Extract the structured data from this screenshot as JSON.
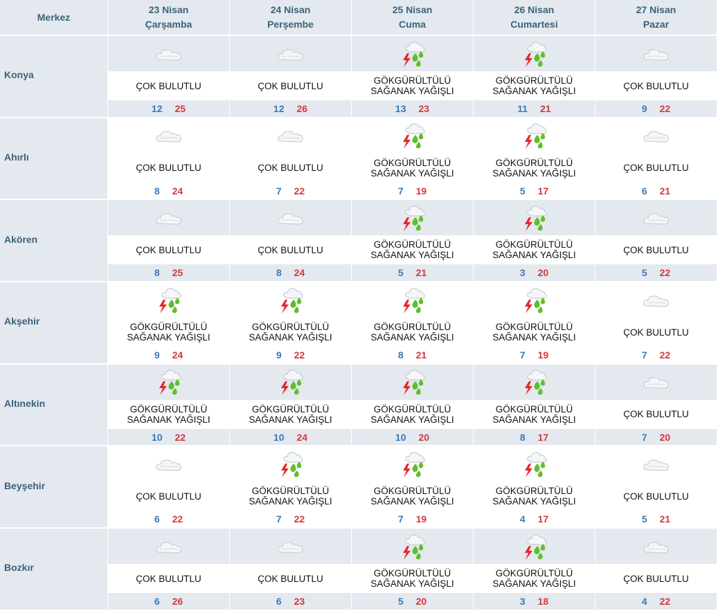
{
  "header": {
    "corner": "Merkez",
    "days": [
      {
        "date": "23 Nisan",
        "weekday": "Çarşamba"
      },
      {
        "date": "24 Nisan",
        "weekday": "Perşembe"
      },
      {
        "date": "25 Nisan",
        "weekday": "Cuma"
      },
      {
        "date": "26 Nisan",
        "weekday": "Cumartesi"
      },
      {
        "date": "27 Nisan",
        "weekday": "Pazar"
      }
    ]
  },
  "colors": {
    "header_bg": "#e3e9ef",
    "header_text": "#3d6277",
    "min_temp": "#3b78b8",
    "max_temp": "#d3393a"
  },
  "rows": [
    {
      "city": "Konya",
      "days": [
        {
          "icon": "cloud-icon",
          "line1": "ÇOK BULUTLU",
          "line2": "",
          "min": "12",
          "max": "25"
        },
        {
          "icon": "cloud-icon",
          "line1": "ÇOK BULUTLU",
          "line2": "",
          "min": "12",
          "max": "26"
        },
        {
          "icon": "thunder-shower-icon",
          "line1": "GÖKGÜRÜLTÜLÜ",
          "line2": "SAĞANAK YAĞIŞLI",
          "min": "13",
          "max": "23"
        },
        {
          "icon": "thunder-shower-icon",
          "line1": "GÖKGÜRÜLTÜLÜ",
          "line2": "SAĞANAK YAĞIŞLI",
          "min": "11",
          "max": "21"
        },
        {
          "icon": "cloud-icon",
          "line1": "ÇOK BULUTLU",
          "line2": "",
          "min": "9",
          "max": "22"
        }
      ]
    },
    {
      "city": "Ahırlı",
      "days": [
        {
          "icon": "cloud-icon",
          "line1": "ÇOK BULUTLU",
          "line2": "",
          "min": "8",
          "max": "24"
        },
        {
          "icon": "cloud-icon",
          "line1": "ÇOK BULUTLU",
          "line2": "",
          "min": "7",
          "max": "22"
        },
        {
          "icon": "thunder-shower-icon",
          "line1": "GÖKGÜRÜLTÜLÜ",
          "line2": "SAĞANAK YAĞIŞLI",
          "min": "7",
          "max": "19"
        },
        {
          "icon": "thunder-shower-icon",
          "line1": "GÖKGÜRÜLTÜLÜ",
          "line2": "SAĞANAK YAĞIŞLI",
          "min": "5",
          "max": "17"
        },
        {
          "icon": "cloud-icon",
          "line1": "ÇOK BULUTLU",
          "line2": "",
          "min": "6",
          "max": "21"
        }
      ]
    },
    {
      "city": "Akören",
      "days": [
        {
          "icon": "cloud-icon",
          "line1": "ÇOK BULUTLU",
          "line2": "",
          "min": "8",
          "max": "25"
        },
        {
          "icon": "cloud-icon",
          "line1": "ÇOK BULUTLU",
          "line2": "",
          "min": "8",
          "max": "24"
        },
        {
          "icon": "thunder-shower-icon",
          "line1": "GÖKGÜRÜLTÜLÜ",
          "line2": "SAĞANAK YAĞIŞLI",
          "min": "5",
          "max": "21"
        },
        {
          "icon": "thunder-shower-icon",
          "line1": "GÖKGÜRÜLTÜLÜ",
          "line2": "SAĞANAK YAĞIŞLI",
          "min": "3",
          "max": "20"
        },
        {
          "icon": "cloud-icon",
          "line1": "ÇOK BULUTLU",
          "line2": "",
          "min": "5",
          "max": "22"
        }
      ]
    },
    {
      "city": "Akşehir",
      "days": [
        {
          "icon": "thunder-shower-icon",
          "line1": "GÖKGÜRÜLTÜLÜ",
          "line2": "SAĞANAK YAĞIŞLI",
          "min": "9",
          "max": "24"
        },
        {
          "icon": "thunder-shower-icon",
          "line1": "GÖKGÜRÜLTÜLÜ",
          "line2": "SAĞANAK YAĞIŞLI",
          "min": "9",
          "max": "22"
        },
        {
          "icon": "thunder-shower-icon",
          "line1": "GÖKGÜRÜLTÜLÜ",
          "line2": "SAĞANAK YAĞIŞLI",
          "min": "8",
          "max": "21"
        },
        {
          "icon": "thunder-shower-icon",
          "line1": "GÖKGÜRÜLTÜLÜ",
          "line2": "SAĞANAK YAĞIŞLI",
          "min": "7",
          "max": "19"
        },
        {
          "icon": "cloud-icon",
          "line1": "ÇOK BULUTLU",
          "line2": "",
          "min": "7",
          "max": "22"
        }
      ]
    },
    {
      "city": "Altınekin",
      "days": [
        {
          "icon": "thunder-shower-icon",
          "line1": "GÖKGÜRÜLTÜLÜ",
          "line2": "SAĞANAK YAĞIŞLI",
          "min": "10",
          "max": "22"
        },
        {
          "icon": "thunder-shower-icon",
          "line1": "GÖKGÜRÜLTÜLÜ",
          "line2": "SAĞANAK YAĞIŞLI",
          "min": "10",
          "max": "24"
        },
        {
          "icon": "thunder-shower-icon",
          "line1": "GÖKGÜRÜLTÜLÜ",
          "line2": "SAĞANAK YAĞIŞLI",
          "min": "10",
          "max": "20"
        },
        {
          "icon": "thunder-shower-icon",
          "line1": "GÖKGÜRÜLTÜLÜ",
          "line2": "SAĞANAK YAĞIŞLI",
          "min": "8",
          "max": "17"
        },
        {
          "icon": "cloud-icon",
          "line1": "ÇOK BULUTLU",
          "line2": "",
          "min": "7",
          "max": "20"
        }
      ]
    },
    {
      "city": "Beyşehir",
      "days": [
        {
          "icon": "cloud-icon",
          "line1": "ÇOK BULUTLU",
          "line2": "",
          "min": "6",
          "max": "22"
        },
        {
          "icon": "thunder-shower-icon",
          "line1": "GÖKGÜRÜLTÜLÜ",
          "line2": "SAĞANAK YAĞIŞLI",
          "min": "7",
          "max": "22"
        },
        {
          "icon": "thunder-shower-icon",
          "line1": "GÖKGÜRÜLTÜLÜ",
          "line2": "SAĞANAK YAĞIŞLI",
          "min": "7",
          "max": "19"
        },
        {
          "icon": "thunder-shower-icon",
          "line1": "GÖKGÜRÜLTÜLÜ",
          "line2": "SAĞANAK YAĞIŞLI",
          "min": "4",
          "max": "17"
        },
        {
          "icon": "cloud-icon",
          "line1": "ÇOK BULUTLU",
          "line2": "",
          "min": "5",
          "max": "21"
        }
      ]
    },
    {
      "city": "Bozkır",
      "days": [
        {
          "icon": "cloud-icon",
          "line1": "ÇOK BULUTLU",
          "line2": "",
          "min": "6",
          "max": "26"
        },
        {
          "icon": "cloud-icon",
          "line1": "ÇOK BULUTLU",
          "line2": "",
          "min": "6",
          "max": "23"
        },
        {
          "icon": "thunder-shower-icon",
          "line1": "GÖKGÜRÜLTÜLÜ",
          "line2": "SAĞANAK YAĞIŞLI",
          "min": "5",
          "max": "20"
        },
        {
          "icon": "thunder-shower-icon",
          "line1": "GÖKGÜRÜLTÜLÜ",
          "line2": "SAĞANAK YAĞIŞLI",
          "min": "3",
          "max": "18"
        },
        {
          "icon": "cloud-icon",
          "line1": "ÇOK BULUTLU",
          "line2": "",
          "min": "4",
          "max": "22"
        }
      ]
    }
  ]
}
